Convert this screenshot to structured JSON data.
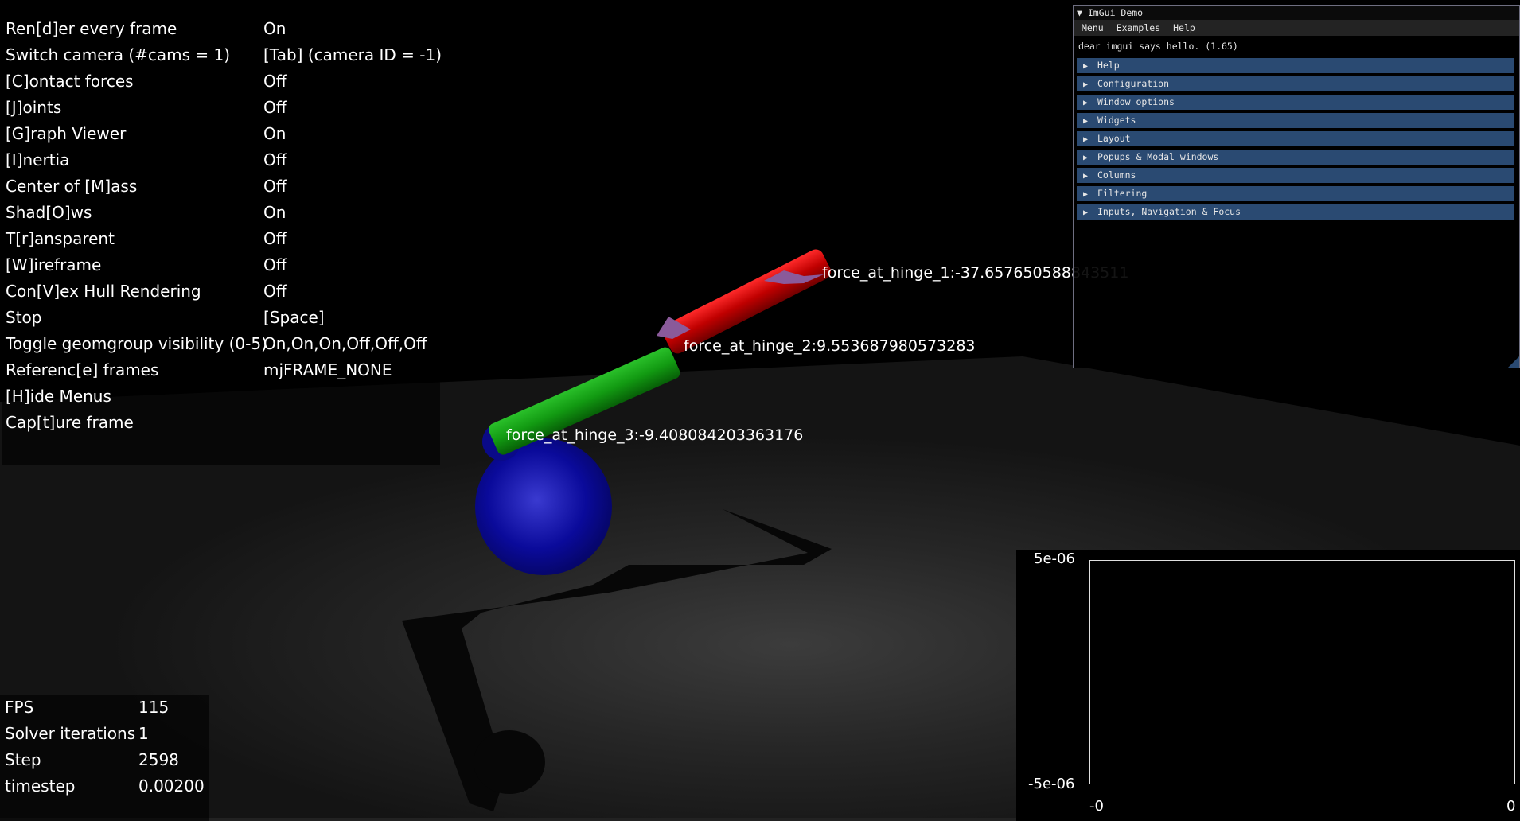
{
  "menu": {
    "items": [
      {
        "label": "Ren[d]er every frame",
        "value": "On"
      },
      {
        "label": "Switch camera (#cams = 1)",
        "value": "[Tab] (camera ID = -1)"
      },
      {
        "label": "[C]ontact forces",
        "value": "Off"
      },
      {
        "label": "[J]oints",
        "value": "Off"
      },
      {
        "label": "[G]raph Viewer",
        "value": "On"
      },
      {
        "label": "[I]nertia",
        "value": "Off"
      },
      {
        "label": "Center of [M]ass",
        "value": "Off"
      },
      {
        "label": "Shad[O]ws",
        "value": "On"
      },
      {
        "label": "T[r]ansparent",
        "value": "Off"
      },
      {
        "label": "[W]ireframe",
        "value": "Off"
      },
      {
        "label": "Con[V]ex Hull Rendering",
        "value": "Off"
      },
      {
        "label": "Stop",
        "value": "[Space]"
      },
      {
        "label": "Toggle geomgroup visibility (0-5)",
        "value": "On,On,On,Off,Off,Off"
      },
      {
        "label": "Referenc[e] frames",
        "value": "mjFRAME_NONE"
      },
      {
        "label": "[H]ide Menus",
        "value": ""
      },
      {
        "label": "Cap[t]ure frame",
        "value": ""
      }
    ]
  },
  "info": {
    "rows": [
      {
        "label": "FPS",
        "value": "115"
      },
      {
        "label": "Solver iterations",
        "value": "1"
      },
      {
        "label": "Step",
        "value": "2598"
      },
      {
        "label": "timestep",
        "value": "0.00200"
      }
    ]
  },
  "forces": {
    "hinge1": "force_at_hinge_1:-37.657650588843511",
    "hinge2": "force_at_hinge_2:9.553687980573283",
    "hinge3": "force_at_hinge_3:-9.408084203363176"
  },
  "imgui": {
    "title": "ImGui Demo",
    "collapse_icon": "triangle-down-icon",
    "menubar": [
      "Menu",
      "Examples",
      "Help"
    ],
    "hello": "dear imgui says hello. (1.65)",
    "headers": [
      "Help",
      "Configuration",
      "Window options",
      "Widgets",
      "Layout",
      "Popups & Modal windows",
      "Columns",
      "Filtering",
      "Inputs, Navigation & Focus"
    ],
    "header_icon": "triangle-right-icon"
  },
  "plot": {
    "y_top": "5e-06",
    "y_bottom": "-5e-06",
    "x_left": "-0",
    "x_right": "0"
  },
  "chart_data": {
    "type": "line",
    "title": "",
    "series": [],
    "ylim": [
      -5e-06,
      5e-06
    ],
    "xlim": [
      0,
      0
    ],
    "grid": false
  },
  "colors": {
    "header": "#2a4a72",
    "link1": "#d01010",
    "link2": "#1a9a1a",
    "base": "#0a0aa0",
    "arrow": "#8a5a9a"
  }
}
